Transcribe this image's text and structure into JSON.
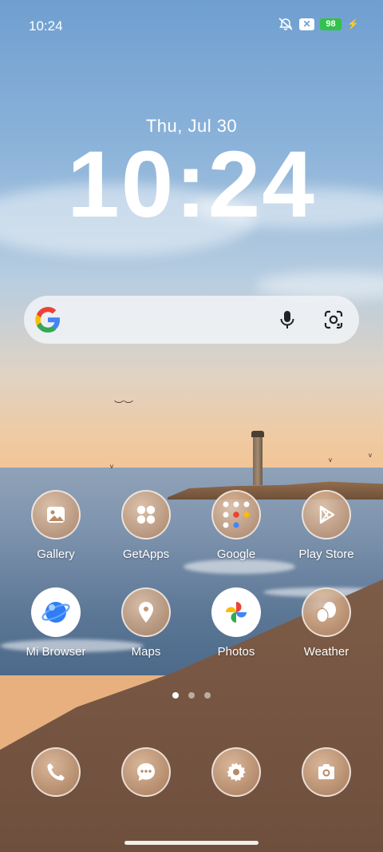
{
  "status_bar": {
    "time": "10:24",
    "battery": "98",
    "icons": [
      "bell-muted-icon",
      "x-notification-icon",
      "battery-icon",
      "charging-icon"
    ]
  },
  "lock_widget": {
    "date": "Thu, Jul 30",
    "time": "10:24"
  },
  "search_bar": {
    "icons": [
      "google-logo-icon",
      "microphone-icon",
      "google-lens-icon"
    ]
  },
  "apps_row1": [
    {
      "label": "Gallery",
      "icon": "gallery-icon"
    },
    {
      "label": "GetApps",
      "icon": "getapps-icon"
    },
    {
      "label": "Google",
      "icon": "google-folder-icon"
    },
    {
      "label": "Play Store",
      "icon": "play-store-icon"
    }
  ],
  "apps_row2": [
    {
      "label": "Mi Browser",
      "icon": "mi-browser-icon"
    },
    {
      "label": "Maps",
      "icon": "maps-icon"
    },
    {
      "label": "Photos",
      "icon": "photos-icon"
    },
    {
      "label": "Weather",
      "icon": "weather-icon"
    }
  ],
  "page_indicator": {
    "pages": 3,
    "current": 1
  },
  "dock": [
    {
      "name": "phone",
      "icon": "phone-icon"
    },
    {
      "name": "messages",
      "icon": "message-icon"
    },
    {
      "name": "settings",
      "icon": "settings-icon"
    },
    {
      "name": "camera",
      "icon": "camera-icon"
    }
  ],
  "colors": {
    "battery_green": "#33c24b"
  }
}
